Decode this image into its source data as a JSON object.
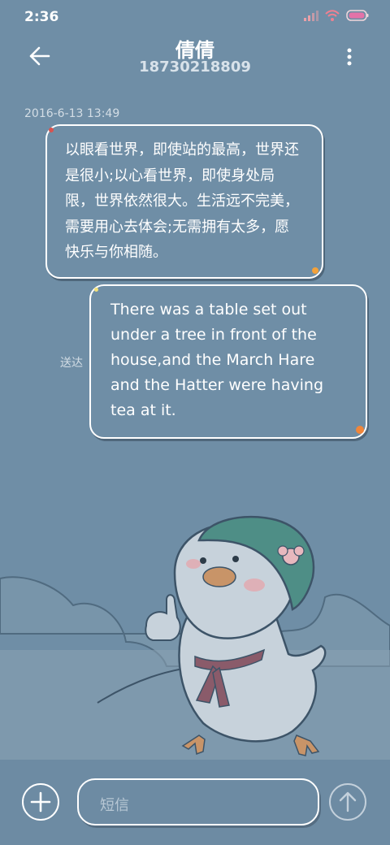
{
  "status_bar": {
    "time": "2:36"
  },
  "header": {
    "contact_name": "倩倩",
    "contact_number": "18730218809"
  },
  "conversation": {
    "timestamp": "2016-6-13 13:49",
    "messages": [
      {
        "direction": "incoming",
        "text": "以眼看世界，即使站的最高，世界还是很小;以心看世界，即使身处局限，世界依然很大。生活远不完美，需要用心去体会;无需拥有太多，愿快乐与你相随。"
      },
      {
        "direction": "outgoing",
        "text": "There was a table set out under a tree in front of the house,and the March Hare and the Hatter were having tea at it.",
        "status": "送达"
      }
    ]
  },
  "composer": {
    "placeholder": "短信"
  },
  "icons": {
    "back": "back-arrow-icon",
    "menu": "more-vert-icon",
    "add": "plus-icon",
    "send": "up-arrow-icon",
    "signal": "signal-icon",
    "wifi": "wifi-icon",
    "battery": "battery-icon"
  },
  "colors": {
    "background": "#6f8ea6",
    "text": "#ffffff",
    "accent_bubble_dot": "#f3a23a"
  }
}
